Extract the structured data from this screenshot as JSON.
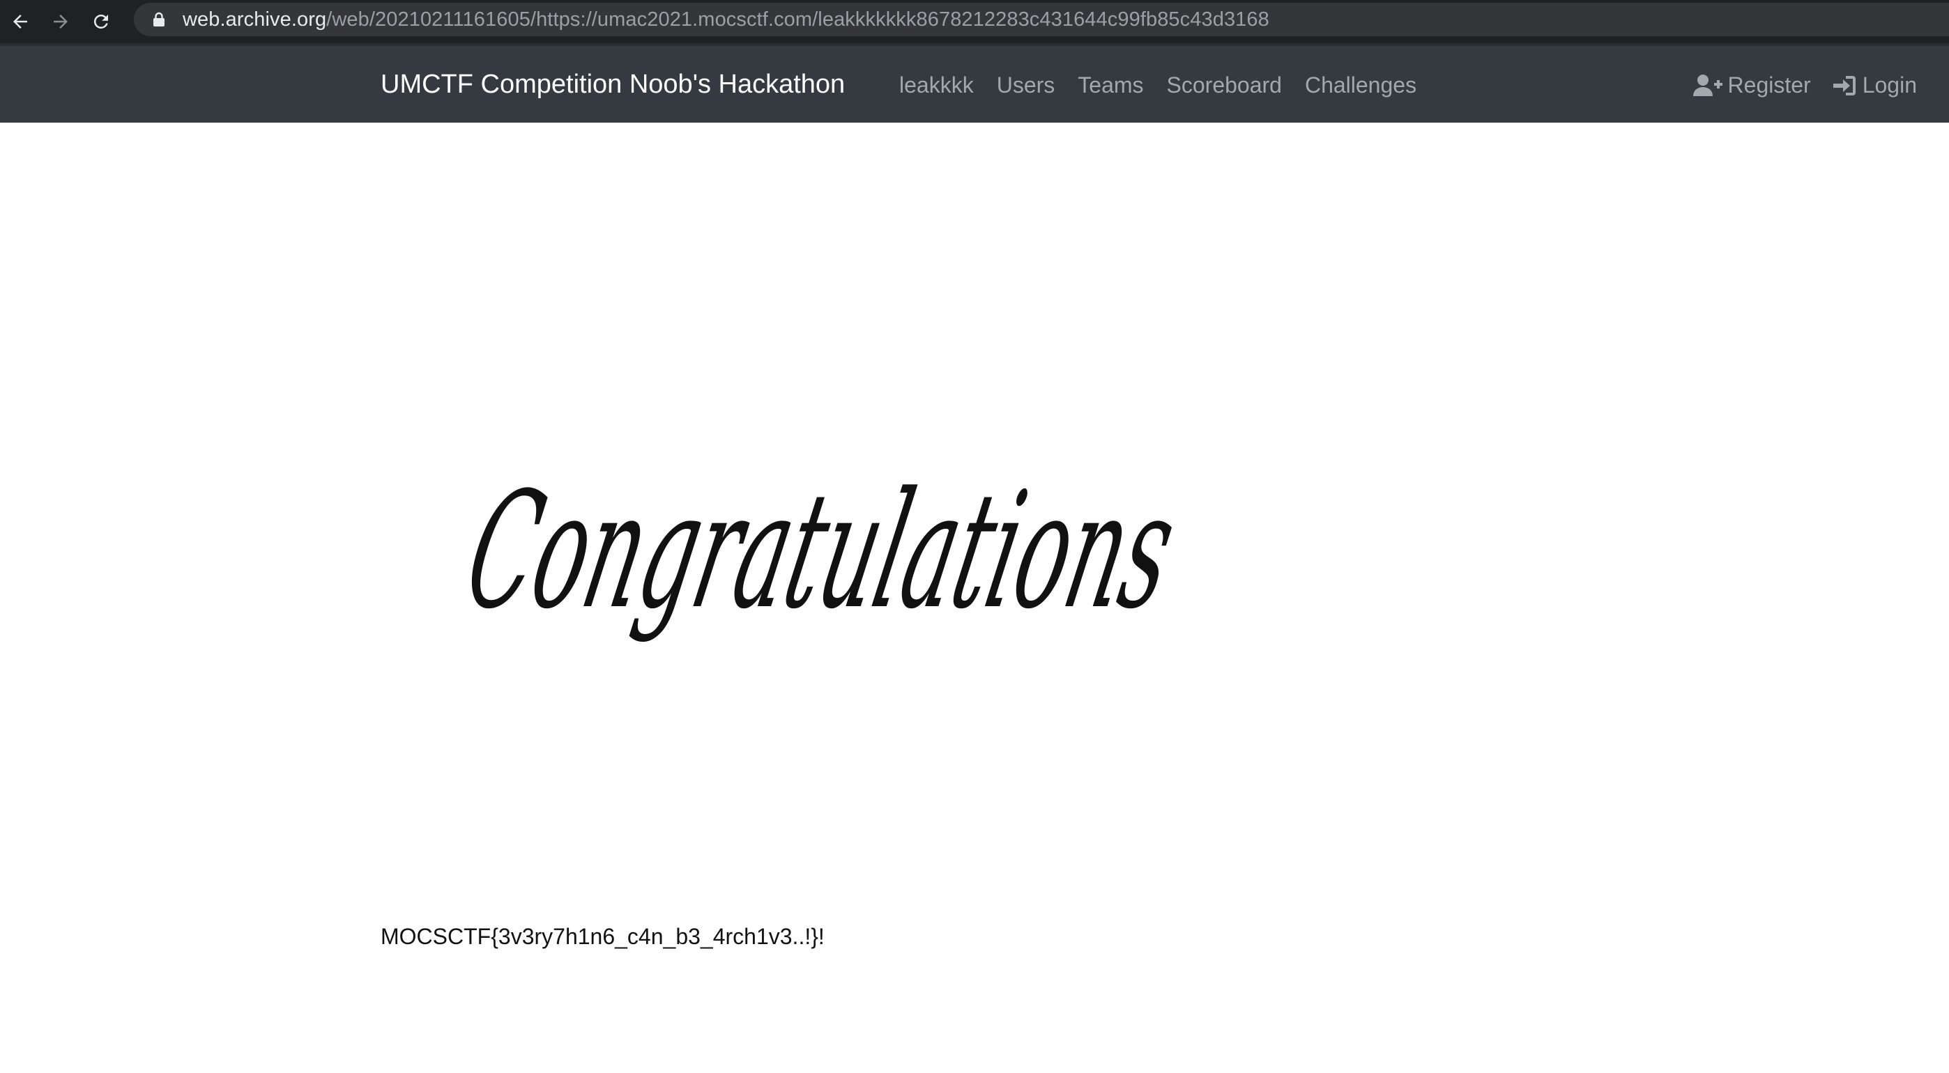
{
  "browser": {
    "url_host": "web.archive.org",
    "url_path": "/web/20210211161605/https://umac2021.mocsctf.com/leakkkkkkk8678212283c431644c99fb85c43d3168"
  },
  "navbar": {
    "brand": "UMCTF Competition Noob's Hackathon",
    "links": [
      {
        "label": "leakkkk"
      },
      {
        "label": "Users"
      },
      {
        "label": "Teams"
      },
      {
        "label": "Scoreboard"
      },
      {
        "label": "Challenges"
      }
    ],
    "register_label": "Register",
    "login_label": "Login"
  },
  "main": {
    "hero_text": "Congratulations",
    "flag": "MOCSCTF{3v3ry7h1n6_c4n_b3_4rch1v3..!}!"
  },
  "colors": {
    "browser_bg": "#202124",
    "url_pill_bg": "#35363a",
    "navbar_bg": "#343a40",
    "nav_link": "#a3a8ad",
    "brand": "#ffffff"
  },
  "icons": {
    "back": "arrow-left-icon",
    "forward": "arrow-right-icon",
    "reload": "reload-icon",
    "lock": "lock-icon",
    "register": "user-plus-icon",
    "login": "sign-in-icon"
  }
}
